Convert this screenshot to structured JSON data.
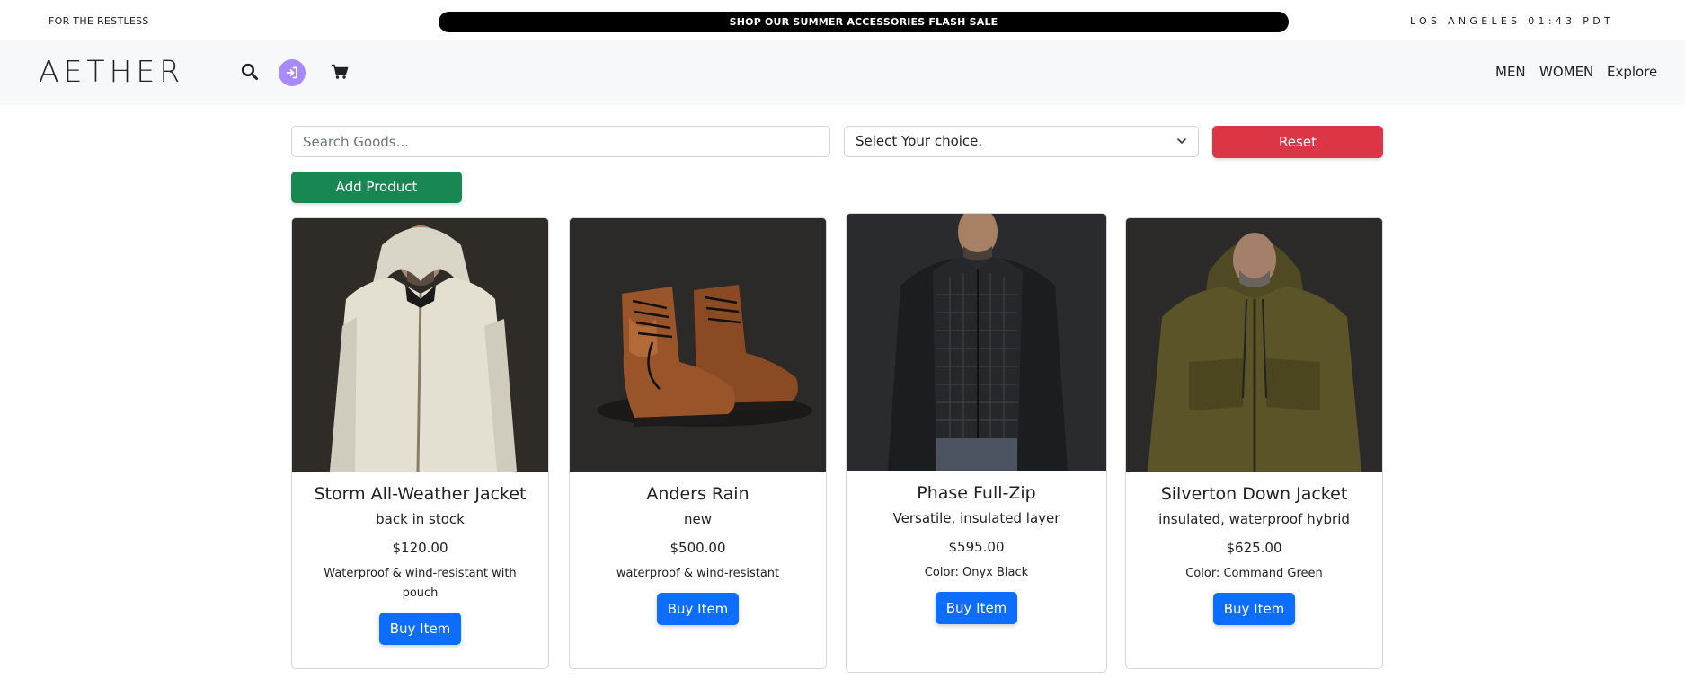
{
  "topbar": {
    "tagline": "FOR THE RESTLESS",
    "promo": "SHOP OUR SUMMER ACCESSORIES FLASH SALE",
    "clock": "LOS ANGELES 01:43 PDT"
  },
  "header": {
    "logo": "AETHER",
    "nav": {
      "men": "MEN",
      "women": "WOMEN",
      "explore": "Explore"
    },
    "icons": [
      "search-icon",
      "login-icon",
      "cart-icon"
    ],
    "login_icon_color": "#a78bfa"
  },
  "filters": {
    "search_placeholder": "Search Goods...",
    "search_value": "",
    "select_value": "Select Your choice.",
    "reset_label": "Reset",
    "add_label": "Add Product"
  },
  "colors": {
    "reset": "#dc3545",
    "add": "#198754",
    "buy": "#0d6efd",
    "promo_bg": "#000000",
    "header_bg": "#f7f8fa"
  },
  "products": [
    {
      "title": "Storm All-Weather Jacket",
      "subtitle": "back in stock",
      "price": "$120.00",
      "detail": "Waterproof & wind-resistant with pouch",
      "buy_label": "Buy Item"
    },
    {
      "title": "Anders Rain",
      "subtitle": "new",
      "price": "$500.00",
      "detail": "waterproof & wind-resistant",
      "buy_label": "Buy Item"
    },
    {
      "title": "Phase Full-Zip",
      "subtitle": "Versatile, insulated layer",
      "price": "$595.00",
      "detail": "Color: Onyx Black",
      "buy_label": "Buy Item"
    },
    {
      "title": "Silverton Down Jacket",
      "subtitle": "insulated, waterproof hybrid",
      "price": "$625.00",
      "detail": "Color: Command Green",
      "buy_label": "Buy Item"
    }
  ]
}
